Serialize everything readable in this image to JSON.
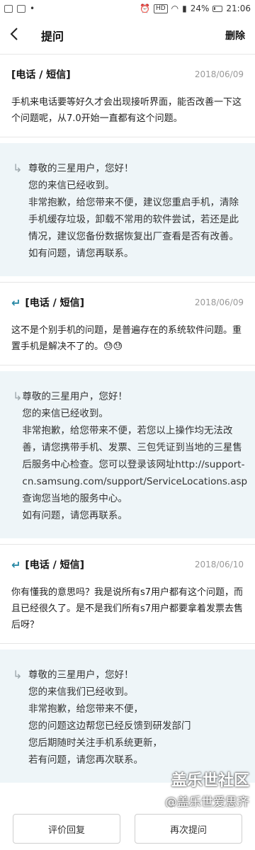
{
  "status": {
    "hd": "HD",
    "battery": "24%",
    "time": "21:06"
  },
  "header": {
    "title": "提问",
    "delete_label": "删除"
  },
  "thread": [
    {
      "kind": "question",
      "followup": false,
      "tag": "[电话 / 短信]",
      "date": "2018/06/09",
      "body": "手机来电话要等好久才会出现接听界面，能否改善一下这个问题呢，从7.0开始一直都有这个问题。"
    },
    {
      "kind": "answer",
      "lines": [
        "尊敬的三星用户，您好！",
        "您的来信已经收到。",
        "非常抱歉，给您带来不便，建议您重启手机，清除手机缓存垃圾，卸载不常用的软件尝试，若还是此情况，建议您备份数据恢复出厂查看是否有改善。",
        "如有问题，请您再联系。"
      ]
    },
    {
      "kind": "question",
      "followup": true,
      "tag": "[电话 / 短信]",
      "date": "2018/06/09",
      "body": "这不是个别手机的问题，是普遍存在的系统软件问题。重置手机是解决不了的。😓😓"
    },
    {
      "kind": "answer",
      "lines": [
        "尊敬的三星用户，您好！",
        "您的来信已经收到。",
        "非常抱歉，给您带来不便，若您以上操作均无法改善，请您携带手机、发票、三包凭证到当地的三星售后服务中心检查。您可以登录该网址http://support-cn.samsung.com/support/ServiceLocations.asp查询您当地的服务中心。",
        "如有问题，请您再联系。"
      ]
    },
    {
      "kind": "question",
      "followup": true,
      "tag": "[电话 / 短信]",
      "date": "2018/06/10",
      "body": "你有懂我的意思吗？我是说所有s7用户都有这个问题，而且已经很久了。是不是我们所有s7用户都要拿着发票去售后呀？"
    },
    {
      "kind": "answer",
      "lines": [
        "尊敬的三星用户，您好！",
        "您的来信我们已经收到。",
        "非常抱歉，给您带来不便，",
        "您的问题这边帮您已经反馈到研发部门",
        "您后期随时关注手机系统更新，",
        "若有问题，请您再次联系。"
      ]
    }
  ],
  "bottom": {
    "rate_label": "评价回复",
    "second_label": "再次提问"
  },
  "watermark": {
    "line1": "盖乐世社区",
    "line2": "@盖乐世爱思齐"
  }
}
